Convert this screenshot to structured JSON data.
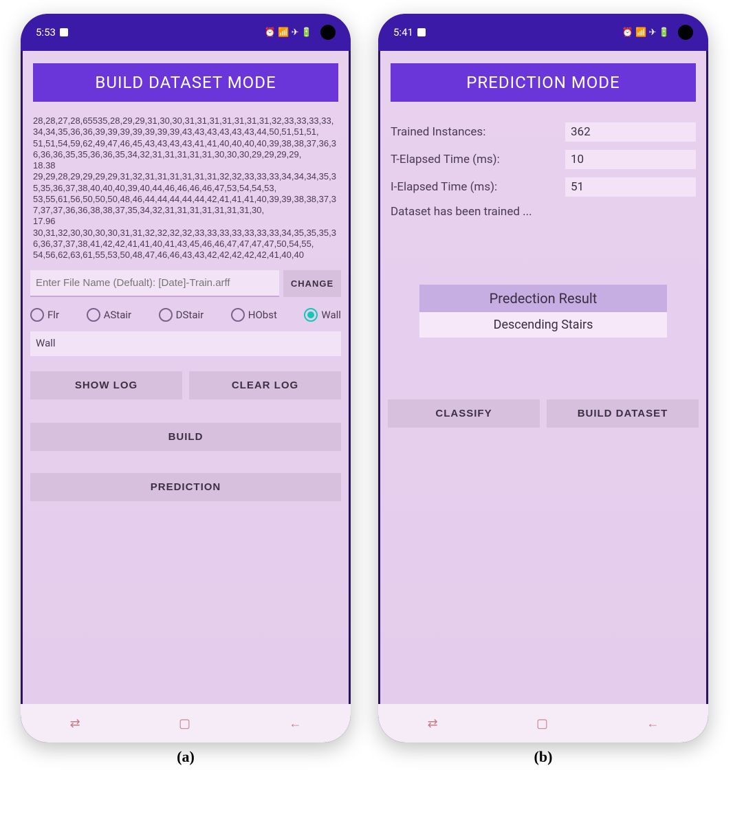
{
  "figure_labels": {
    "a": "(a)",
    "b": "(b)"
  },
  "status_icons_text": "⏰ 📶 ✈ 🔋",
  "build": {
    "status_time": "5:53",
    "title": "BUILD DATASET MODE",
    "log": "28,28,27,28,65535,28,29,29,31,30,30,31,31,31,31,31,31,31,32,33,33,33,33,34,34,35,36,36,39,39,39,39,39,39,39,43,43,43,43,43,43,44,50,51,51,51,\n51,51,54,59,62,49,47,46,45,43,43,43,43,41,41,40,40,40,40,39,38,38,37,36,36,36,36,35,35,36,36,35,34,32,31,31,31,31,31,30,30,30,29,29,29,29,\n18.38\n29,29,28,29,29,29,29,31,32,31,31,31,31,31,31,32,32,33,33,33,34,34,34,35,35,35,36,37,38,40,40,40,39,40,44,46,46,46,46,47,53,54,54,53,\n53,55,61,56,50,50,50,48,46,44,44,44,44,44,42,41,41,41,40,39,39,38,38,37,37,37,37,36,36,38,38,37,35,34,32,31,31,31,31,31,31,31,30,\n17.96\n30,31,32,30,30,30,30,31,31,32,32,32,32,33,33,33,33,33,33,33,34,35,35,35,36,36,37,37,38,41,42,42,41,41,40,41,43,45,46,46,47,47,47,47,50,54,55,\n54,56,62,63,61,55,53,50,48,47,46,46,43,43,42,42,42,42,42,41,40,40",
    "file_placeholder": "Enter File Name (Defualt): [Date]-Train.arff",
    "change_btn": "CHANGE",
    "radios": [
      "Flr",
      "AStair",
      "DStair",
      "HObst",
      "Wall"
    ],
    "radio_selected_index": 4,
    "selected_text": "Wall",
    "show_log_btn": "SHOW LOG",
    "clear_log_btn": "CLEAR LOG",
    "build_btn": "BUILD",
    "prediction_btn": "PREDICTION"
  },
  "predict": {
    "status_time": "5:41",
    "title": "PREDICTION MODE",
    "rows": {
      "trained_label": "Trained Instances:",
      "trained_value": "362",
      "t_label": "T-Elapsed Time (ms):",
      "t_value": "10",
      "i_label": "I-Elapsed Time (ms):",
      "i_value": "51"
    },
    "status_text": "Dataset has been trained ...",
    "result_title": "Predection Result",
    "result_value": "Descending Stairs",
    "classify_btn": "CLASSIFY",
    "build_dataset_btn": "BUILD DATASET"
  }
}
